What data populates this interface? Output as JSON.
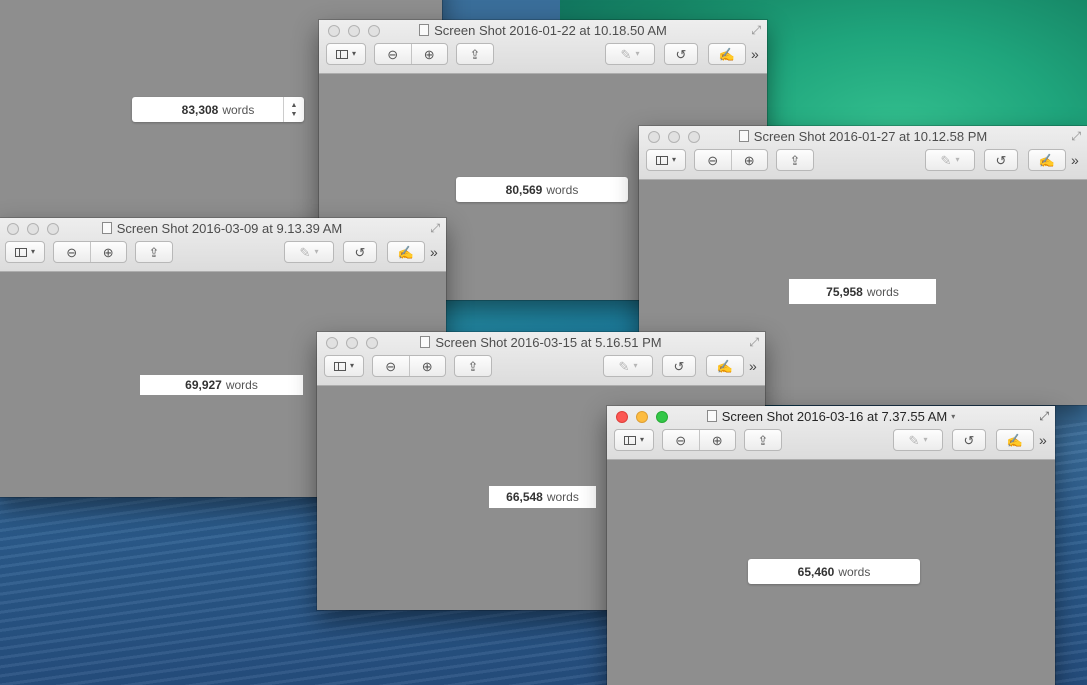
{
  "colors": {
    "content_gray": "#8e8e8e",
    "close": "#fc5753",
    "minimize": "#fdbc40",
    "zoom": "#33c748"
  },
  "icons": {
    "sidebar": "sidebar-icon",
    "zoom_out": "zoom-out-icon",
    "zoom_in": "zoom-in-icon",
    "share": "share-icon",
    "highlight": "highlighter-icon",
    "rotate": "rotate-icon",
    "markup": "markup-pen-icon",
    "more": "chevrons-right-icon",
    "fullscreen": "fullscreen-arrows-icon"
  },
  "toolbar_glyphs": {
    "zoom_out": "⊖",
    "zoom_in": "⊕",
    "share": "⇪",
    "highlight": "✎",
    "rotate": "↺",
    "markup": "✍",
    "more": "»",
    "dropdown": "▾",
    "fullscreen": "⤢",
    "step_up": "▲",
    "step_down": "▼"
  },
  "words_label": "words",
  "windows": {
    "w0": {
      "title": "",
      "count": "83,308"
    },
    "w1": {
      "title": "Screen Shot 2016-01-22 at 10.18.50 AM",
      "count": "80,569"
    },
    "w2": {
      "title": "Screen Shot 2016-01-27 at 10.12.58 PM",
      "count": "75,958"
    },
    "w3": {
      "title": "Screen Shot 2016-03-09 at 9.13.39 AM",
      "count": "69,927"
    },
    "w4": {
      "title": "Screen Shot 2016-03-15 at 5.16.51 PM",
      "count": "66,548"
    },
    "w5": {
      "title": "Screen Shot 2016-03-16 at 7.37.55 AM",
      "count": "65,460"
    }
  }
}
